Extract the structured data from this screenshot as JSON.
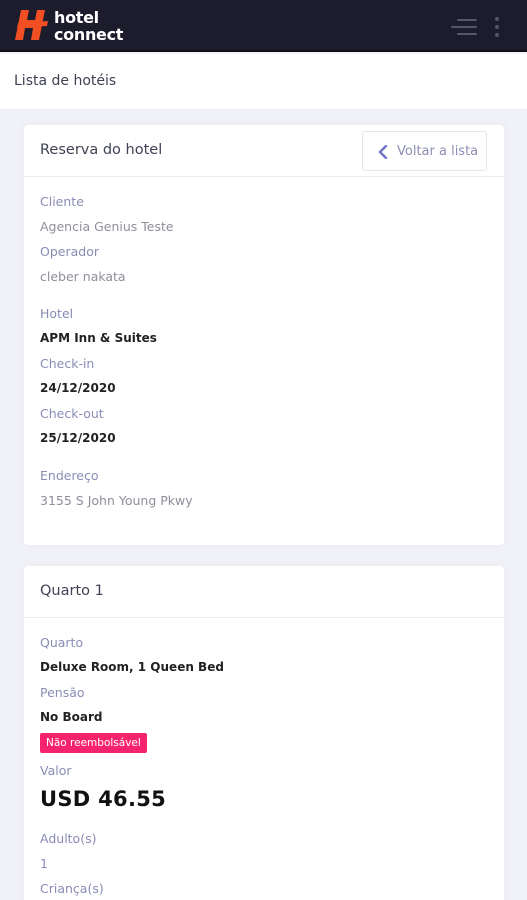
{
  "app": {
    "logo_line1": "hotel",
    "logo_line2": "connect",
    "brand_color": "#f04e23"
  },
  "subheader": {
    "title": "Lista de hotéis"
  },
  "reservation": {
    "title": "Reserva do hotel",
    "back_label": "Voltar a lista",
    "cliente_label": "Cliente",
    "cliente_value": "Agencia Genius Teste",
    "operador_label": "Operador",
    "operador_value": "cleber nakata",
    "hotel_label": "Hotel",
    "hotel_value": "APM Inn & Suites",
    "checkin_label": "Check-in",
    "checkin_value": "24/12/2020",
    "checkout_label": "Check-out",
    "checkout_value": "25/12/2020",
    "endereco_label": "Endereço",
    "endereco_value": "3155 S John Young Pkwy"
  },
  "room": {
    "title": "Quarto 1",
    "quarto_label": "Quarto",
    "quarto_value": "Deluxe Room, 1 Queen Bed",
    "pensao_label": "Pensão",
    "pensao_value": "No Board",
    "badge": "Não reembolsável",
    "valor_label": "Valor",
    "valor_value": "USD 46.55",
    "adultos_label": "Adulto(s)",
    "adultos_value": "1",
    "criancas_label": "Criança(s)"
  }
}
